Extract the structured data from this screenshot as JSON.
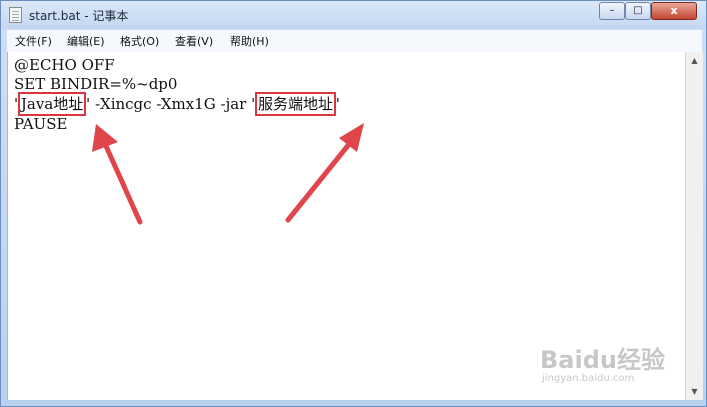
{
  "window": {
    "title": "start.bat - 记事本",
    "controls": {
      "minimize": "–",
      "maximize": "□",
      "close": "x"
    }
  },
  "menu": {
    "items": [
      "文件(F)",
      "编辑(E)",
      "格式(O)",
      "查看(V)",
      "帮助(H)"
    ]
  },
  "editor": {
    "lines": {
      "line1": "@ECHO OFF",
      "line2": "SET BINDIR=%~dp0",
      "line3_open_quote": "\"",
      "line3_java": "Java地址",
      "line3_middle": "\" -Xincgc -Xmx1G -jar \"",
      "line3_server": "服务端地址",
      "line3_close_quote": "\"",
      "line4": "PAUSE"
    }
  },
  "scrollbar": {
    "up": "▲",
    "down": "▼"
  },
  "watermark": {
    "brand": "Baidu经验",
    "url": "jingyan.baidu.com"
  },
  "colors": {
    "annotation": "#d9363e"
  }
}
